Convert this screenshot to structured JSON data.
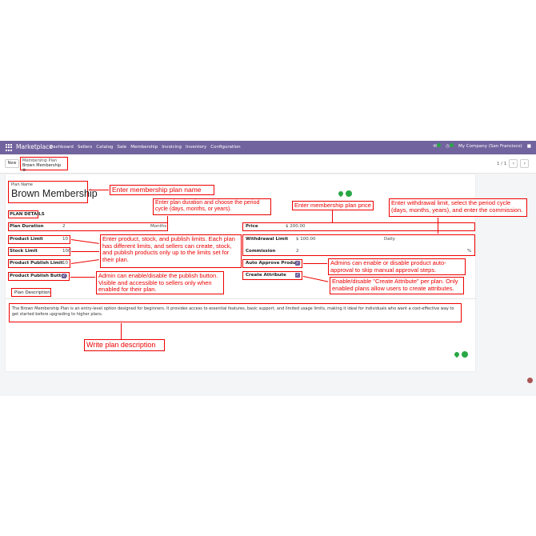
{
  "topbar": {
    "brand": "Marketplace",
    "nav": [
      "Dashboard",
      "Sellers",
      "Catalog",
      "Sale",
      "Membership",
      "Invoicing",
      "Inventory",
      "Configuration"
    ],
    "company": "My Company (San Francisco)"
  },
  "control": {
    "new_label": "New",
    "breadcrumb_parent": "Membership Plan",
    "breadcrumb_current": "Brown Membership",
    "pager": "1 / 1"
  },
  "form": {
    "plan_name_label": "Plan Name",
    "plan_name_value": "Brown Membership",
    "section_title": "PLAN DETAILS",
    "plan_duration_label": "Plan Duration",
    "plan_duration_value": "2",
    "plan_duration_unit": "Months",
    "product_limit_label": "Product Limit",
    "product_limit_value": "10",
    "stock_limit_label": "Stock Limit",
    "stock_limit_value": "100",
    "product_publish_limit_label": "Product Publish Limit",
    "product_publish_limit_value": "10",
    "product_publish_button_label": "Product Publish Button",
    "price_label": "Price",
    "price_value": "$ 200.00",
    "withdrawal_limit_label": "Withdrawal Limit",
    "withdrawal_limit_value": "$ 100.00",
    "withdrawal_period": "Daily",
    "commission_label": "Commission",
    "commission_value": "2",
    "commission_unit": "%",
    "auto_approve_label": "Auto Approve Product",
    "create_attribute_label": "Create Attribute",
    "tab_label": "Plan Description",
    "description": "The Brown Membership Plan is an entry-level option designed for beginners. It provides access to essential features, basic support, and limited usage limits, making it ideal for individuals who want a cost-effective way to get started before upgrading to higher plans."
  },
  "annotations": {
    "name": "Enter membership plan name",
    "duration": "Enter plan duration and choose the period cycle (days, months, or years).",
    "price": "Enter membership plan price",
    "withdrawal": "Enter withdrawal limit, select the period cycle (days, months, years), and enter the commission.",
    "limits": "Enter product, stock, and publish limits. Each plan has different limits, and sellers can create, stock, and publish products only up to the limits set for their plan.",
    "publish_button": "Admin can enable/disable the publish button. Visible and accessible to sellers only when enabled for their plan.",
    "auto_approve": "Admins can enable or disable product auto-approval to skip manual approval steps.",
    "create_attribute": "Enable/disable \"Create Attribute\" per plan. Only enabled plans allow users to create attributes.",
    "description": "Write plan description"
  },
  "colors": {
    "topbar": "#71639e",
    "annotation": "#e00000",
    "accent": "#28a745"
  }
}
